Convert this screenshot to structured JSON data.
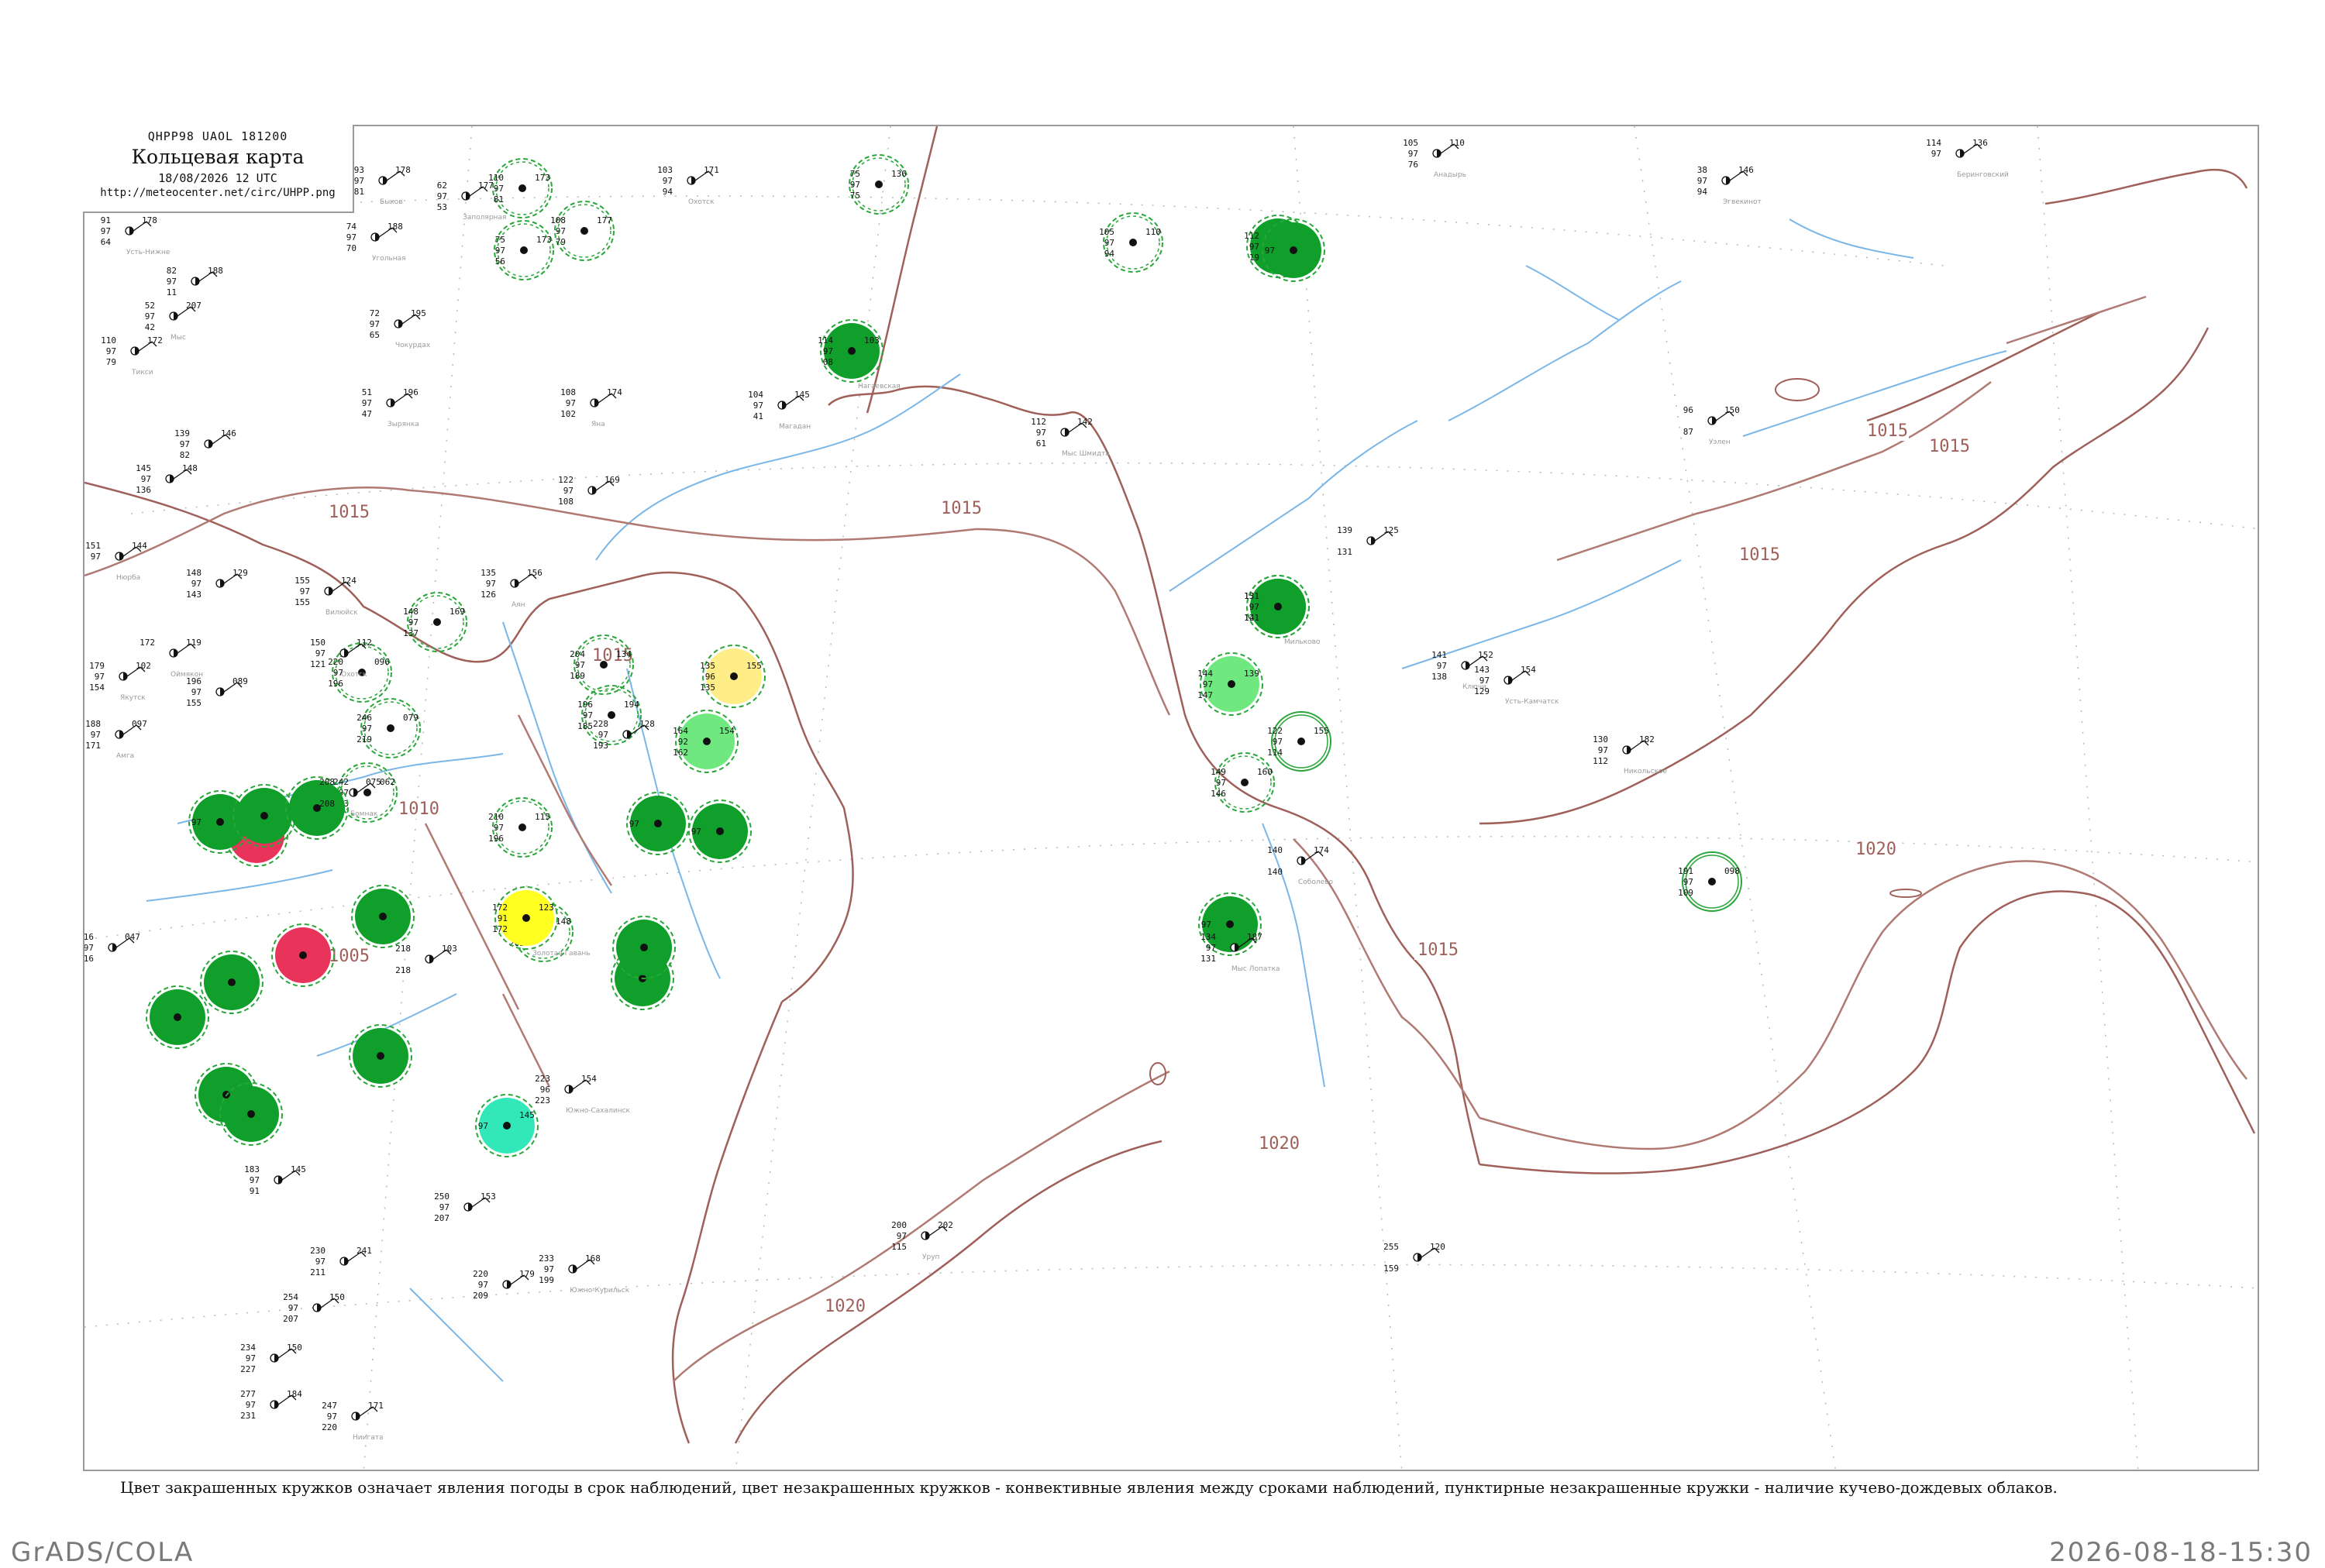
{
  "header": {
    "code_line": "QHPP98  UAOL  181200",
    "title": "Кольцевая карта",
    "date_line": "18/08/2026 12 UTC",
    "url": "http://meteocenter.net/circ/UHPP.png"
  },
  "legend_note": "Цвет закрашенных кружков означает явления погоды в срок наблюдений, цвет незакрашенных кружков - конвективные явления между сроками наблюдений, пунктирные незакрашенные кружки - наличие кучево-дождевых облаков.",
  "footer": {
    "left": "GrADS/COLA",
    "right": "2026-08-18-15:30"
  },
  "colors": {
    "isobar": "#a0605a",
    "rivers": "#7ab7e8",
    "grid": "#b0b0b0",
    "rain": "#0f9f2a",
    "light_green": "#6ee87f",
    "thunder": "#e8345a",
    "yellow": "#ffff22",
    "pale_yellow": "#ffee88",
    "teal": "#33e8b8",
    "dashed_ring": "#2aa63a"
  },
  "isobars": [
    {
      "label": "1015"
    },
    {
      "label": "1015"
    },
    {
      "label": "1015"
    },
    {
      "label": "1015"
    },
    {
      "label": "1015"
    },
    {
      "label": "1010"
    },
    {
      "label": "1005"
    },
    {
      "label": "1015"
    },
    {
      "label": "1020"
    },
    {
      "label": "1020"
    },
    {
      "label": "1020"
    },
    {
      "label": "1015"
    }
  ],
  "stations": [
    {
      "id": "s1",
      "type": "rain",
      "data": [
        "112",
        "97",
        "19",
        "09"
      ],
      "name": ""
    },
    {
      "id": "s2",
      "type": "rain",
      "data": [
        "114",
        "97",
        "08",
        "103"
      ],
      "name": "Нагаевская"
    },
    {
      "id": "s3",
      "type": "rain",
      "data": [
        "155",
        "97",
        "123"
      ],
      "name": ""
    },
    {
      "id": "s4",
      "type": "rain",
      "data": [
        "131",
        "97",
        "141"
      ],
      "name": "Мильково"
    },
    {
      "id": "s5",
      "type": "light_green",
      "data": [
        "144",
        "97",
        "147",
        "139"
      ],
      "name": ""
    },
    {
      "id": "s6",
      "type": "rain",
      "data": [
        "",
        "97",
        "",
        ""
      ],
      "name": ""
    },
    {
      "id": "s7",
      "type": "rain",
      "data": [
        "",
        "97",
        "",
        ""
      ],
      "name": ""
    },
    {
      "id": "s8",
      "type": "rain",
      "data": [
        "",
        "97",
        "",
        ""
      ],
      "name": ""
    },
    {
      "id": "s9",
      "type": "thunder",
      "data": [
        "",
        "",
        "",
        ""
      ],
      "name": ""
    },
    {
      "id": "s10",
      "type": "rain",
      "data": [
        "",
        "97",
        "",
        ""
      ],
      "name": ""
    },
    {
      "id": "s11",
      "type": "rain",
      "data": [
        "",
        "",
        "",
        ""
      ],
      "name": ""
    },
    {
      "id": "s12",
      "type": "rain",
      "data": [
        "",
        "",
        "",
        ""
      ],
      "name": ""
    },
    {
      "id": "s13",
      "type": "thunder",
      "data": [
        "",
        "",
        "",
        ""
      ],
      "name": ""
    },
    {
      "id": "s14",
      "type": "rain",
      "data": [
        "",
        "",
        "",
        ""
      ],
      "name": ""
    },
    {
      "id": "s15",
      "type": "rain",
      "data": [
        "",
        "",
        "",
        ""
      ],
      "name": ""
    },
    {
      "id": "s16",
      "type": "rain",
      "data": [
        "",
        "",
        "",
        ""
      ],
      "name": ""
    },
    {
      "id": "s17",
      "type": "rain",
      "data": [
        "",
        "",
        "",
        ""
      ],
      "name": ""
    },
    {
      "id": "s18",
      "type": "rain",
      "data": [
        "",
        "",
        "",
        ""
      ],
      "name": ""
    },
    {
      "id": "s19",
      "type": "rain",
      "data": [
        "",
        "",
        "",
        ""
      ],
      "name": ""
    },
    {
      "id": "s20",
      "type": "rain",
      "data": [
        "",
        "",
        "",
        ""
      ],
      "name": ""
    },
    {
      "id": "s21",
      "type": "rain",
      "data": [
        "",
        "",
        "",
        ""
      ],
      "name": ""
    },
    {
      "id": "s22",
      "type": "yellow",
      "data": [
        "172",
        "91",
        "172",
        "123"
      ],
      "name": "Золотая Гавань"
    },
    {
      "id": "s23",
      "type": "pale_yellow",
      "data": [
        "135",
        "96",
        "135",
        "155"
      ],
      "name": ""
    },
    {
      "id": "s24",
      "type": "light_green",
      "data": [
        "164",
        "92",
        "162",
        "154"
      ],
      "name": ""
    },
    {
      "id": "s25",
      "type": "teal",
      "data": [
        "",
        "97",
        "",
        "145"
      ],
      "name": ""
    },
    {
      "id": "s26",
      "type": "rain",
      "data": [
        "",
        "97",
        "",
        ""
      ],
      "name": ""
    }
  ],
  "rings": [
    {
      "id": "r1",
      "style": "dashed",
      "data": [
        "110",
        "97",
        "81",
        "173"
      ]
    },
    {
      "id": "r2",
      "style": "dashed",
      "data": [
        "75",
        "97",
        "56",
        "173"
      ]
    },
    {
      "id": "r3",
      "style": "dashed",
      "data": [
        "108",
        "97",
        "79",
        "177"
      ]
    },
    {
      "id": "r4",
      "style": "dashed",
      "data": [
        "75",
        "97",
        "75",
        "136"
      ]
    },
    {
      "id": "r5",
      "style": "dashed",
      "data": [
        "105",
        "97",
        "94",
        "110"
      ]
    },
    {
      "id": "r6",
      "style": "dashed",
      "data": [
        "204",
        "97",
        "189",
        "134"
      ]
    },
    {
      "id": "r7",
      "style": "dashed",
      "data": [
        "196",
        "97",
        "185",
        "194"
      ]
    },
    {
      "id": "r8",
      "style": "dashed",
      "data": [
        "210",
        "97",
        "196",
        "115"
      ]
    },
    {
      "id": "r9",
      "style": "dashed",
      "data": [
        "216",
        "97",
        "203",
        "148"
      ]
    },
    {
      "id": "r10",
      "style": "dashed",
      "data": [
        "148",
        "97",
        "137",
        "169"
      ]
    },
    {
      "id": "r11",
      "style": "dashed",
      "data": [
        "220",
        "97",
        "196",
        "096"
      ]
    },
    {
      "id": "r12",
      "style": "dashed",
      "data": [
        "246",
        "97",
        "219",
        "079"
      ]
    },
    {
      "id": "r13",
      "style": "dashed",
      "data": [
        "242",
        "97",
        "203",
        "062"
      ]
    },
    {
      "id": "r14",
      "style": "dashed",
      "data": [
        "149",
        "97",
        "146",
        "160"
      ]
    },
    {
      "id": "r15",
      "style": "solid",
      "data": [
        "122",
        "97",
        "114",
        "155"
      ]
    },
    {
      "id": "r16",
      "style": "solid",
      "data": [
        "191",
        "97",
        "109",
        "098"
      ]
    }
  ],
  "plain": [
    {
      "id": "p1",
      "data": [
        "93",
        "97",
        "81",
        "178"
      ],
      "name": "Быков"
    },
    {
      "id": "p2",
      "data": [
        "91",
        "97",
        "64",
        "178"
      ],
      "name": "Усть-Нижне"
    },
    {
      "id": "p3",
      "data": [
        "74",
        "97",
        "70",
        "188"
      ],
      "name": "Угольная"
    },
    {
      "id": "p4",
      "data": [
        "62",
        "97",
        "53",
        "177"
      ],
      "name": "Заполярная"
    },
    {
      "id": "p5",
      "data": [
        "82",
        "97",
        "11",
        "188"
      ],
      "name": ""
    },
    {
      "id": "p6",
      "data": [
        "52",
        "97",
        "42",
        "207"
      ],
      "name": "Мыс"
    },
    {
      "id": "p7",
      "data": [
        "110",
        "97",
        "79",
        "172"
      ],
      "name": "Тикси"
    },
    {
      "id": "p8",
      "data": [
        "72",
        "97",
        "65",
        "195"
      ],
      "name": "Чокурдах"
    },
    {
      "id": "p9",
      "data": [
        "51",
        "97",
        "47",
        "196"
      ],
      "name": "Зырянка"
    },
    {
      "id": "p10",
      "data": [
        "108",
        "97",
        "102",
        "174"
      ],
      "name": "Яна"
    },
    {
      "id": "p11",
      "data": [
        "103",
        "97",
        "94",
        "171"
      ],
      "name": "Охотск"
    },
    {
      "id": "p12",
      "data": [
        "104",
        "97",
        "41",
        "145"
      ],
      "name": "Магадан"
    },
    {
      "id": "p13",
      "data": [
        "112",
        "97",
        "61",
        "142"
      ],
      "name": "Мыс Шмидта"
    },
    {
      "id": "p14",
      "data": [
        "105",
        "97",
        "76",
        "110"
      ],
      "name": "Анадырь"
    },
    {
      "id": "p15",
      "data": [
        "38",
        "97",
        "94",
        "146"
      ],
      "name": "Эгвекинот"
    },
    {
      "id": "p16",
      "data": [
        "114",
        "97",
        "",
        "136"
      ],
      "name": "Беринговский"
    },
    {
      "id": "p17",
      "data": [
        "139",
        "97",
        "82",
        "146"
      ],
      "name": ""
    },
    {
      "id": "p18",
      "data": [
        "145",
        "97",
        "136",
        "148"
      ],
      "name": ""
    },
    {
      "id": "p19",
      "data": [
        "151",
        "97",
        "",
        "144"
      ],
      "name": "Нюрба"
    },
    {
      "id": "p20",
      "data": [
        "148",
        "97",
        "143",
        "129"
      ],
      "name": ""
    },
    {
      "id": "p21",
      "data": [
        "155",
        "97",
        "155",
        "124"
      ],
      "name": "Вилюйск"
    },
    {
      "id": "p22",
      "data": [
        "172",
        "",
        "",
        "119"
      ],
      "name": "Оймякон"
    },
    {
      "id": "p23",
      "data": [
        "179",
        "97",
        "154",
        "102"
      ],
      "name": "Якутск"
    },
    {
      "id": "p24",
      "data": [
        "188",
        "97",
        "171",
        "097"
      ],
      "name": "Амга"
    },
    {
      "id": "p25",
      "data": [
        "196",
        "97",
        "155",
        "089"
      ],
      "name": ""
    },
    {
      "id": "p26",
      "data": [
        "150",
        "97",
        "121",
        "112"
      ],
      "name": "Охотск"
    },
    {
      "id": "p27",
      "data": [
        "135",
        "97",
        "126",
        "156"
      ],
      "name": "Аян"
    },
    {
      "id": "p28",
      "data": [
        "122",
        "97",
        "108",
        "169"
      ],
      "name": ""
    },
    {
      "id": "p29",
      "data": [
        "228",
        "97",
        "193",
        "128"
      ],
      "name": ""
    },
    {
      "id": "p30",
      "data": [
        "208",
        "",
        "208",
        "075"
      ],
      "name": "Бомнак"
    },
    {
      "id": "p31",
      "data": [
        "218",
        "",
        "218",
        "103"
      ],
      "name": ""
    },
    {
      "id": "p32",
      "data": [
        "216",
        "97",
        "216",
        "047"
      ],
      "name": ""
    },
    {
      "id": "p33",
      "data": [
        "223",
        "96",
        "223",
        "154"
      ],
      "name": "Южно-Сахалинск"
    },
    {
      "id": "p34",
      "data": [
        "183",
        "97",
        "91",
        "145"
      ],
      "name": ""
    },
    {
      "id": "p35",
      "data": [
        "250",
        "97",
        "207",
        "153"
      ],
      "name": ""
    },
    {
      "id": "p36",
      "data": [
        "220",
        "97",
        "209",
        "179"
      ],
      "name": ""
    },
    {
      "id": "p37",
      "data": [
        "233",
        "97",
        "199",
        "168"
      ],
      "name": "Южно-Курильск"
    },
    {
      "id": "p38",
      "data": [
        "200",
        "97",
        "115",
        "202"
      ],
      "name": "Уруп"
    },
    {
      "id": "p39",
      "data": [
        "255",
        "",
        "159",
        "120"
      ],
      "name": ""
    },
    {
      "id": "p40",
      "data": [
        "141",
        "97",
        "138",
        "152"
      ],
      "name": "Ключи"
    },
    {
      "id": "p41",
      "data": [
        "143",
        "97",
        "129",
        "154"
      ],
      "name": "Усть-Камчатск"
    },
    {
      "id": "p42",
      "data": [
        "139",
        "",
        "131",
        "125"
      ],
      "name": ""
    },
    {
      "id": "p43",
      "data": [
        "130",
        "97",
        "112",
        "182"
      ],
      "name": "Никольское"
    },
    {
      "id": "p44",
      "data": [
        "140",
        "",
        "140",
        "174"
      ],
      "name": "Соболево"
    },
    {
      "id": "p45",
      "data": [
        "134",
        "97",
        "131",
        "187"
      ],
      "name": "Мыс Лопатка"
    },
    {
      "id": "p46",
      "data": [
        "230",
        "97",
        "211",
        "241"
      ],
      "name": ""
    },
    {
      "id": "p47",
      "data": [
        "254",
        "97",
        "207",
        "150"
      ],
      "name": ""
    },
    {
      "id": "p48",
      "data": [
        "234",
        "97",
        "227",
        "150"
      ],
      "name": ""
    },
    {
      "id": "p49",
      "data": [
        "277",
        "97",
        "231",
        "184"
      ],
      "name": ""
    },
    {
      "id": "p50",
      "data": [
        "247",
        "97",
        "220",
        "171"
      ],
      "name": "Ниигата"
    },
    {
      "id": "p51",
      "data": [
        "96",
        "",
        "87",
        "150"
      ],
      "name": "Уэлен"
    }
  ]
}
